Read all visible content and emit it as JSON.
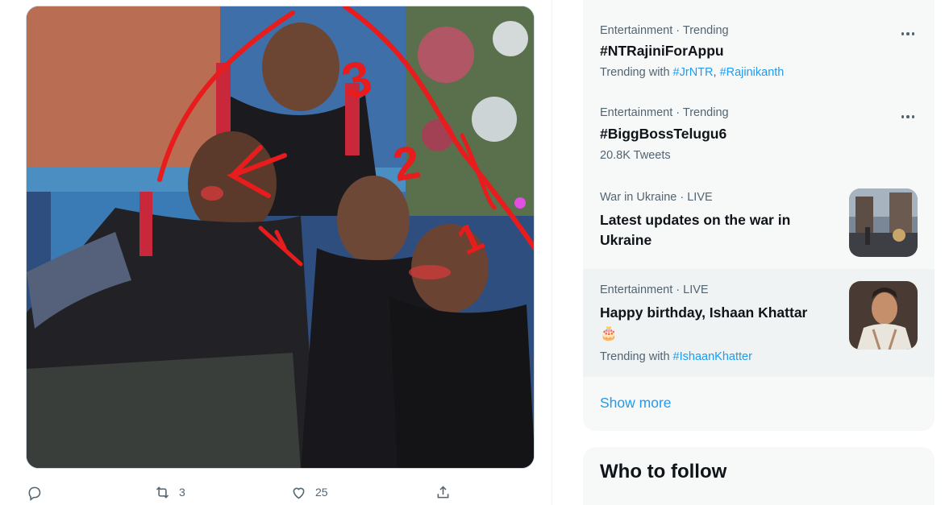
{
  "tweet": {
    "media": {
      "alt_icon": "photo",
      "annotations": [
        "3",
        "2",
        "1"
      ]
    },
    "actions": {
      "reply_count": "",
      "retweet_count": "3",
      "like_count": "25",
      "icons": [
        "reply-icon",
        "retweet-icon",
        "like-icon",
        "share-icon"
      ]
    }
  },
  "trends": {
    "items": [
      {
        "meta": "Entertainment · Trending",
        "title": "#NTRajiniForAppu",
        "sub_prefix": "Trending with ",
        "links": [
          "#JrNTR",
          ", ",
          "#Rajinikanth"
        ],
        "has_more": true
      },
      {
        "meta": "Entertainment · Trending",
        "title": "#BiggBossTelugu6",
        "sub_prefix": "20.8K Tweets",
        "has_more": true
      },
      {
        "meta": "War in Ukraine · LIVE",
        "title": "Latest updates on the war in Ukraine",
        "has_image": true
      },
      {
        "meta": "Entertainment · LIVE",
        "title": "Happy birthday, Ishaan Khattar",
        "emoji": "🎂",
        "sub_prefix": "Trending with ",
        "links": [
          "#IshaanKhatter"
        ],
        "has_image": true
      }
    ],
    "show_more": "Show more"
  },
  "who_to_follow": {
    "title": "Who to follow"
  },
  "colors": {
    "accent": "#1d9bf0",
    "muted": "#536471",
    "panel": "#f7f9f9",
    "highlight": "#eff3f4"
  }
}
